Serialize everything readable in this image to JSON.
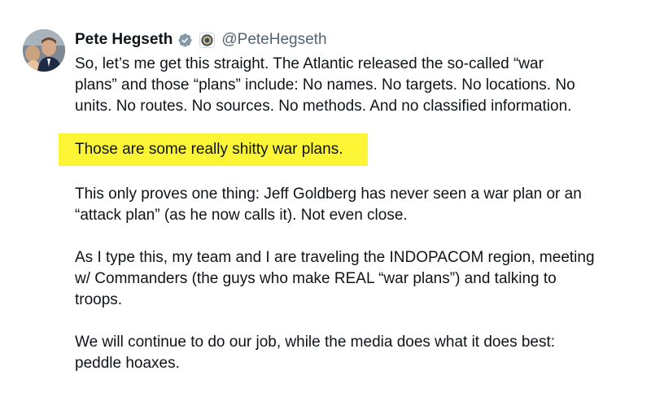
{
  "author": {
    "name": "Pete Hegseth",
    "handle": "@PeteHegseth",
    "badge_icon": "verified-badge-icon",
    "affiliation_icon": "government-seal-icon",
    "badge_color": "#829aab"
  },
  "tweet": {
    "paragraph_1": "So, let’s me get this straight. The Atlantic released the so-called “war\nplans” and those “plans” include: No names. No targets. No locations. No\nunits. No routes. No sources. No methods. And no classified information.",
    "highlighted": "Those are some really shitty war plans.",
    "highlight_color": "#fcf535",
    "paragraph_2": "This only proves one thing: Jeff Goldberg has never seen a war plan or an\n“attack plan” (as he now calls it). Not even close.",
    "paragraph_3": "As I type this, my team and I are traveling the INDOPACOM region, meeting\nw/ Commanders (the guys who make REAL “war plans”) and talking to\ntroops.",
    "paragraph_4": "We will continue to do our job, while the media does what it does best:\npeddle hoaxes."
  }
}
